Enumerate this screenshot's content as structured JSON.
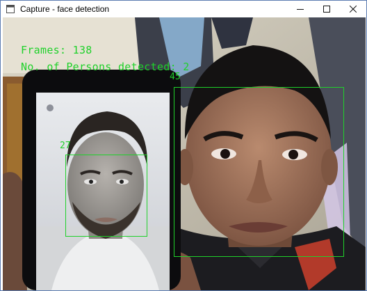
{
  "window": {
    "title": "Capture - face detection",
    "icon": "app-window-icon"
  },
  "controls": {
    "minimize_icon": "minimize-icon",
    "maximize_icon": "maximize-icon",
    "close_icon": "close-icon"
  },
  "overlay": {
    "frames_text": "Frames: 138",
    "persons_text": "No. of Persons detected: 2",
    "color": "#1fd12a"
  },
  "detections": [
    {
      "label": "27"
    },
    {
      "label": "45"
    }
  ]
}
